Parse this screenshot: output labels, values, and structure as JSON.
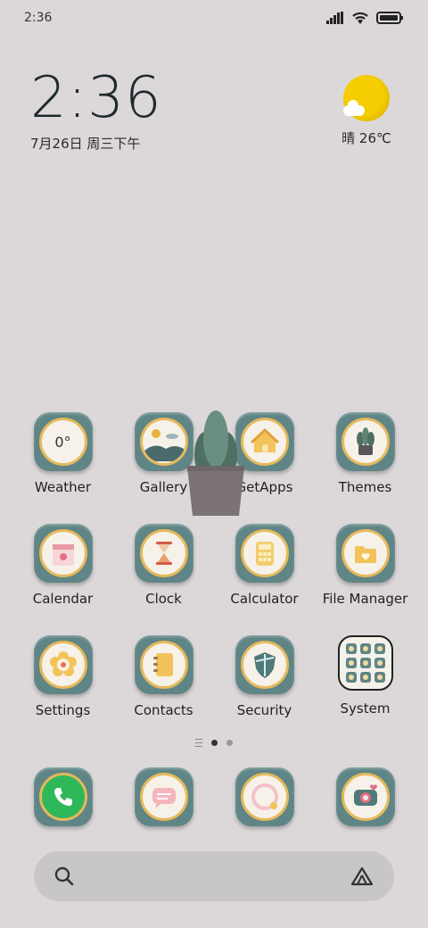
{
  "status": {
    "time": "2:36"
  },
  "clock_widget": {
    "time": "2:36",
    "date": "7月26日 周三下午"
  },
  "weather_widget": {
    "text": "晴 26℃"
  },
  "rows": [
    {
      "apps": [
        {
          "label": "Weather",
          "icon": "weather-icon",
          "inner": "0°"
        },
        {
          "label": "Gallery",
          "icon": "gallery-icon"
        },
        {
          "label": "GetApps",
          "icon": "getapps-icon"
        },
        {
          "label": "Themes",
          "icon": "themes-icon"
        }
      ]
    },
    {
      "apps": [
        {
          "label": "Calendar",
          "icon": "calendar-icon"
        },
        {
          "label": "Clock",
          "icon": "clock-icon"
        },
        {
          "label": "Calculator",
          "icon": "calculator-icon"
        },
        {
          "label": "File Manager",
          "icon": "file-manager-icon"
        }
      ]
    },
    {
      "apps": [
        {
          "label": "Settings",
          "icon": "settings-icon"
        },
        {
          "label": "Contacts",
          "icon": "contacts-icon"
        },
        {
          "label": "Security",
          "icon": "security-icon"
        },
        {
          "label": "System",
          "icon": "system-folder-icon"
        }
      ]
    }
  ],
  "dock": [
    {
      "name": "phone",
      "icon": "phone-icon"
    },
    {
      "name": "messages",
      "icon": "messages-icon"
    },
    {
      "name": "browser",
      "icon": "browser-icon"
    },
    {
      "name": "camera",
      "icon": "camera-icon"
    }
  ],
  "colors": {
    "tile": "#5f8586",
    "disc": "#f6f2ea",
    "ring": "#e5b95b",
    "background": "#dcd8d9"
  }
}
